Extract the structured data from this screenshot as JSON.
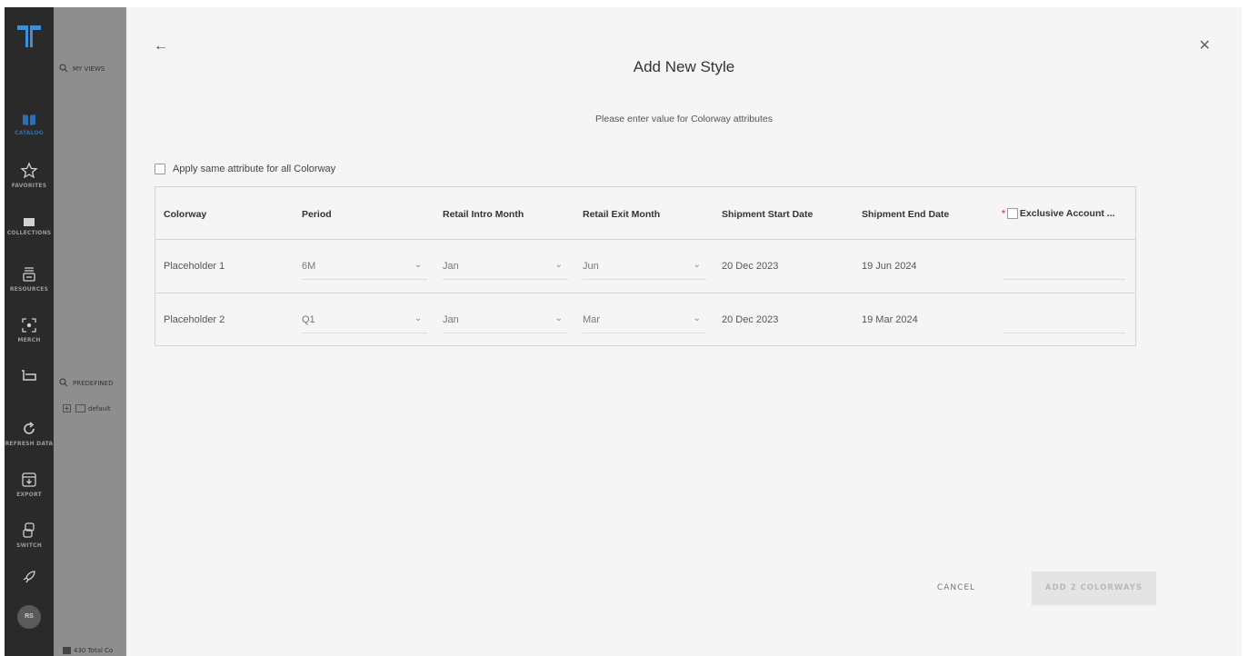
{
  "sidebar": {
    "items": [
      {
        "label": "CATALOG",
        "icon": "book-icon"
      },
      {
        "label": "FAVORITES",
        "icon": "star-icon"
      },
      {
        "label": "COLLECTIONS",
        "icon": "folder-icon"
      },
      {
        "label": "RESOURCES",
        "icon": "stack-icon"
      },
      {
        "label": "MERCH",
        "icon": "focus-frame-icon"
      },
      {
        "label": "",
        "icon": "cart-icon"
      },
      {
        "label": "REFRESH DATA",
        "icon": "refresh-icon"
      },
      {
        "label": "EXPORT",
        "icon": "download-box-icon"
      },
      {
        "label": "SWITCH",
        "icon": "switch-icon"
      },
      {
        "label": "",
        "icon": "rocket-icon"
      }
    ],
    "avatar": "RS",
    "accent_color": "#2b6fb0"
  },
  "background_panel": {
    "my_views": "MY VIEWS",
    "predefined": "PREDEFINED",
    "default_item": "default",
    "footer": "430 Total Co"
  },
  "modal": {
    "title": "Add New Style",
    "subtitle": "Please enter value for Colorway attributes",
    "apply_all_label": "Apply same attribute for all Colorway",
    "columns": {
      "colorway": "Colorway",
      "period": "Period",
      "retail_intro": "Retail Intro Month",
      "retail_exit": "Retail Exit Month",
      "ship_start": "Shipment Start Date",
      "ship_end": "Shipment End Date",
      "exclusive": "Exclusive Account ..."
    },
    "rows": [
      {
        "colorway": "Placeholder 1",
        "period": "6M",
        "retail_intro": "Jan",
        "retail_exit": "Jun",
        "ship_start": "20 Dec 2023",
        "ship_end": "19 Jun 2024",
        "exclusive": ""
      },
      {
        "colorway": "Placeholder 2",
        "period": "Q1",
        "retail_intro": "Jan",
        "retail_exit": "Mar",
        "ship_start": "20 Dec 2023",
        "ship_end": "19 Mar 2024",
        "exclusive": ""
      }
    ],
    "cancel_label": "CANCEL",
    "add_label": "ADD 2 COLORWAYS"
  }
}
